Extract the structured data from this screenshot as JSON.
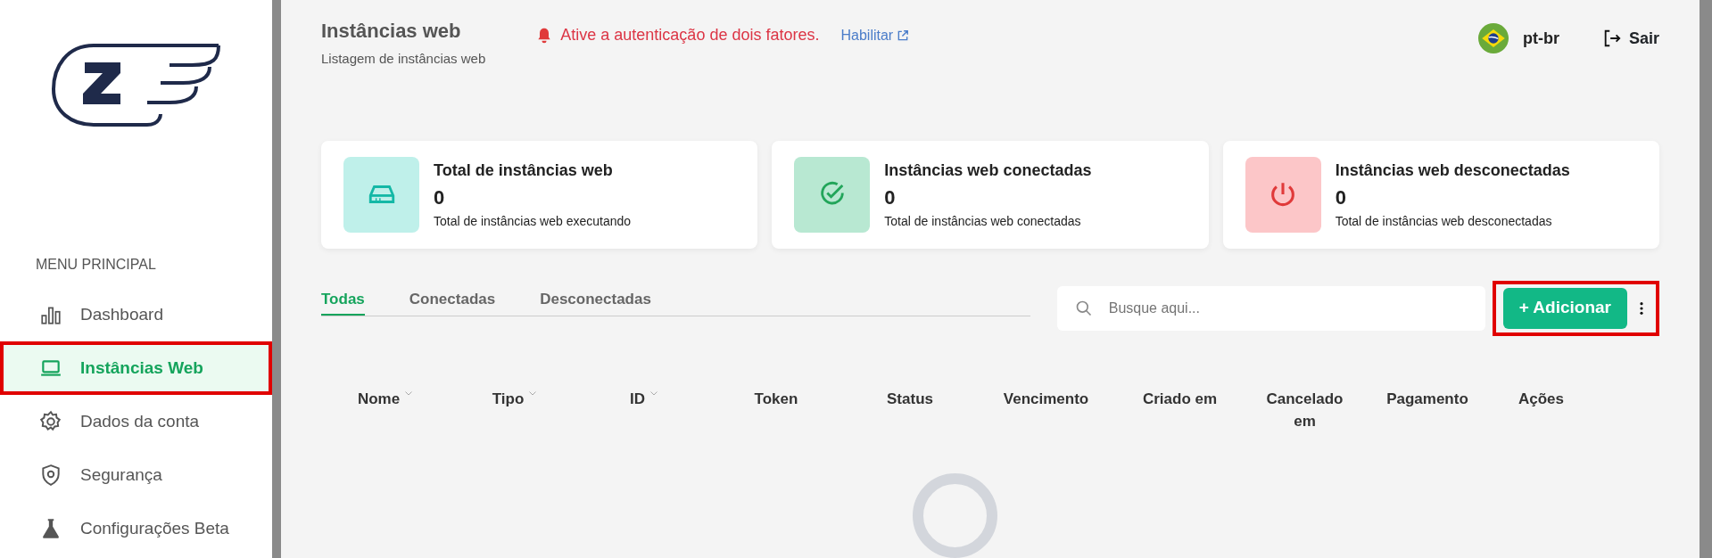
{
  "sidebar": {
    "section_label": "MENU PRINCIPAL",
    "items": [
      {
        "label": "Dashboard",
        "selected": false,
        "highlighted": false
      },
      {
        "label": "Instâncias Web",
        "selected": true,
        "highlighted": true
      },
      {
        "label": "Dados da conta",
        "selected": false,
        "highlighted": false
      },
      {
        "label": "Segurança",
        "selected": false,
        "highlighted": false
      },
      {
        "label": "Configurações Beta",
        "selected": false,
        "highlighted": false
      }
    ]
  },
  "header": {
    "title": "Instâncias web",
    "subtitle": "Listagem de instâncias web",
    "alert": "Ative a autenticação de dois fatores.",
    "alert_link": "Habilitar",
    "language": "pt-br",
    "logout": "Sair"
  },
  "stats": [
    {
      "title": "Total de instâncias web",
      "value": "0",
      "caption": "Total de instâncias web executando",
      "color": "#bff0ea"
    },
    {
      "title": "Instâncias web conectadas",
      "value": "0",
      "caption": "Total de instâncias web conectadas",
      "color": "#b8e8d2"
    },
    {
      "title": "Instâncias web desconectadas",
      "value": "0",
      "caption": "Total de instâncias web desconectadas",
      "color": "#fcc6c8"
    }
  ],
  "tabs": [
    {
      "label": "Todas",
      "selected": true
    },
    {
      "label": "Conectadas",
      "selected": false
    },
    {
      "label": "Desconectadas",
      "selected": false
    }
  ],
  "search": {
    "placeholder": "Busque aqui..."
  },
  "add_button": {
    "label": "+ Adicionar",
    "highlighted": true
  },
  "table": {
    "columns": [
      {
        "label": "Nome",
        "sortable": true
      },
      {
        "label": "Tipo",
        "sortable": true
      },
      {
        "label": "ID",
        "sortable": true
      },
      {
        "label": "Token",
        "sortable": false
      },
      {
        "label": "Status",
        "sortable": false
      },
      {
        "label": "Vencimento",
        "sortable": false
      },
      {
        "label": "Criado em",
        "sortable": false
      },
      {
        "label": "Cancelado em",
        "sortable": false
      },
      {
        "label": "Pagamento",
        "sortable": false
      },
      {
        "label": "Ações",
        "sortable": false
      }
    ]
  }
}
